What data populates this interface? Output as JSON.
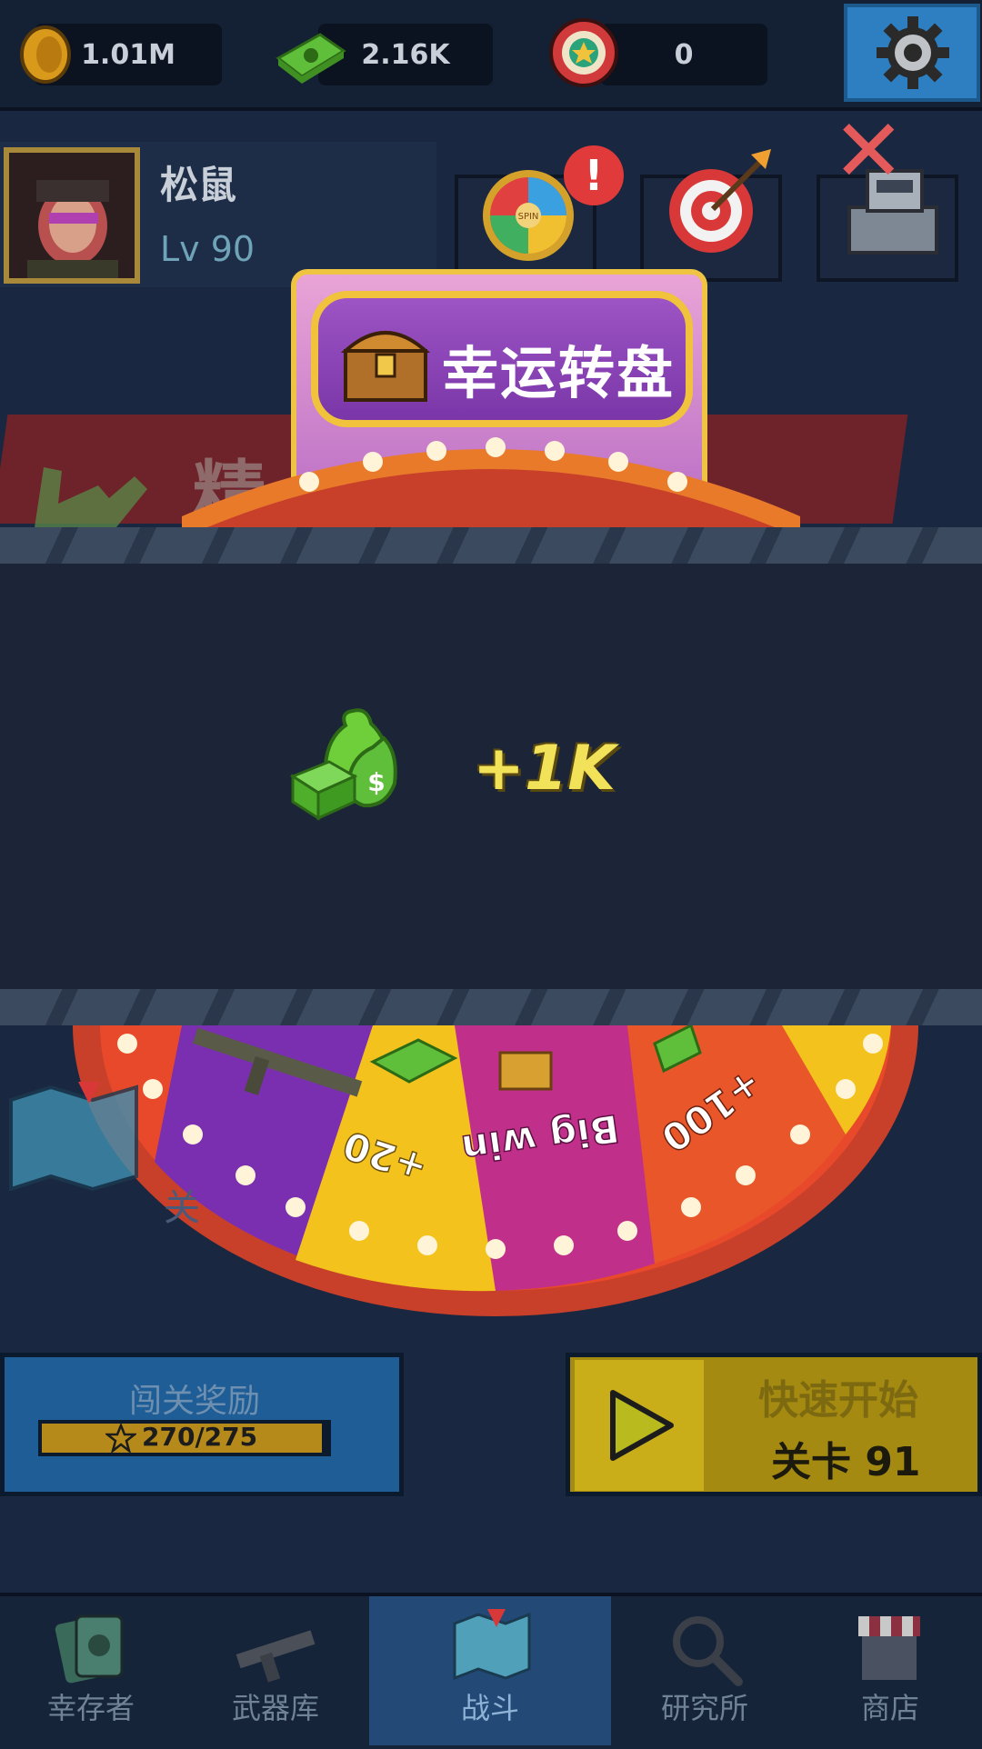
{
  "currencies": {
    "coins": "1.01M",
    "cash": "2.16K",
    "tokens": "0"
  },
  "player": {
    "name": "松鼠",
    "level": "Lv 90"
  },
  "background_banner": {
    "partial_text": "精",
    "partial_text_2": "关"
  },
  "wheel": {
    "title": "幸运转盘",
    "spin_label": "SPIN",
    "segments": [
      "+20",
      "Big win",
      "+100"
    ]
  },
  "reward": {
    "amount": "+1K"
  },
  "stage_reward": {
    "label": "闯关奖励",
    "progress_text": "270/275",
    "progress_fraction": 0.98
  },
  "quick_start": {
    "title": "快速开始",
    "level": "关卡 91"
  },
  "nav": {
    "items": [
      {
        "label": "幸存者"
      },
      {
        "label": "武器库"
      },
      {
        "label": "战斗"
      },
      {
        "label": "研究所"
      },
      {
        "label": "商店"
      }
    ],
    "active_index": 2
  },
  "colors": {
    "accent_gold": "#f1c23c",
    "wheel_purple": "#8a44b8",
    "reward_yellow": "#f2e25a",
    "close_red": "#e45a5a"
  }
}
